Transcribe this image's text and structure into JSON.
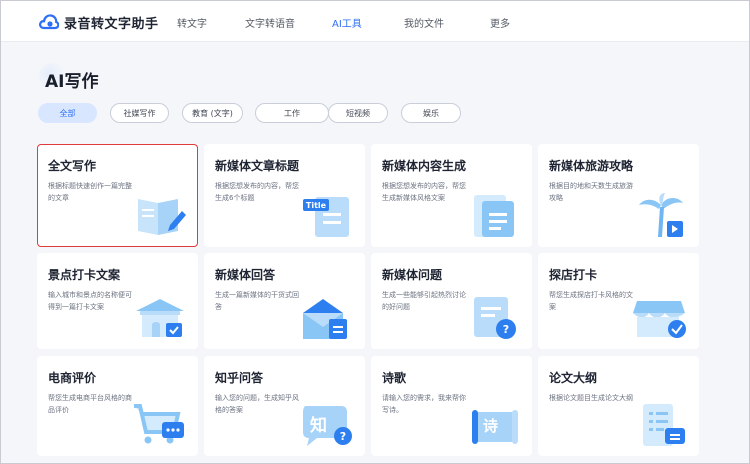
{
  "header": {
    "brand": "录音转文字助手",
    "nav": [
      {
        "label": "转文字",
        "active": false
      },
      {
        "label": "文字转语音",
        "active": false
      },
      {
        "label": "AI工具",
        "active": true
      },
      {
        "label": "我的文件",
        "active": false
      },
      {
        "label": "更多",
        "active": false
      }
    ]
  },
  "page": {
    "title": "AI写作"
  },
  "filters": [
    {
      "label": "全部",
      "active": true
    },
    {
      "label": "社媒写作",
      "active": false
    },
    {
      "label": "教育 (文字)",
      "active": false
    },
    {
      "label": "工作",
      "active": false
    },
    {
      "label": "短视频",
      "active": false
    },
    {
      "label": "娱乐",
      "active": false
    }
  ],
  "cards": [
    {
      "title": "全文写作",
      "desc": "根据标题快速创作一篇完整的文章",
      "icon": "book-pen-icon"
    },
    {
      "title": "新媒体文章标题",
      "desc": "根据您想发布的内容，帮您生成6个标题",
      "icon": "title-doc-icon"
    },
    {
      "title": "新媒体内容生成",
      "desc": "根据您想发布的内容，帮您生成新媒体风格文案",
      "icon": "document-icon"
    },
    {
      "title": "新媒体旅游攻略",
      "desc": "根据目的地和天数生成旅游攻略",
      "icon": "palm-tree-icon"
    },
    {
      "title": "景点打卡文案",
      "desc": "输入城市和景点的名称便可得到一篇打卡文案",
      "icon": "pavilion-icon"
    },
    {
      "title": "新媒体回答",
      "desc": "生成一篇新媒体的干货式回答",
      "icon": "envelope-doc-icon"
    },
    {
      "title": "新媒体问题",
      "desc": "生成一些能够引起热烈讨论的好问题",
      "icon": "question-doc-icon"
    },
    {
      "title": "探店打卡",
      "desc": "帮您生成探店打卡风格的文案",
      "icon": "shop-check-icon"
    },
    {
      "title": "电商评价",
      "desc": "帮您生成电商平台风格的商品评价",
      "icon": "cart-chat-icon"
    },
    {
      "title": "知乎问答",
      "desc": "输入您的问题，生成知乎风格的答案",
      "icon": "zhihu-bubble-icon"
    },
    {
      "title": "诗歌",
      "desc": "请输入您的需求，我来帮你写诗。",
      "icon": "poem-scroll-icon"
    },
    {
      "title": "论文大纲",
      "desc": "根据论文题目生成论文大纲",
      "icon": "outline-doc-icon"
    }
  ]
}
